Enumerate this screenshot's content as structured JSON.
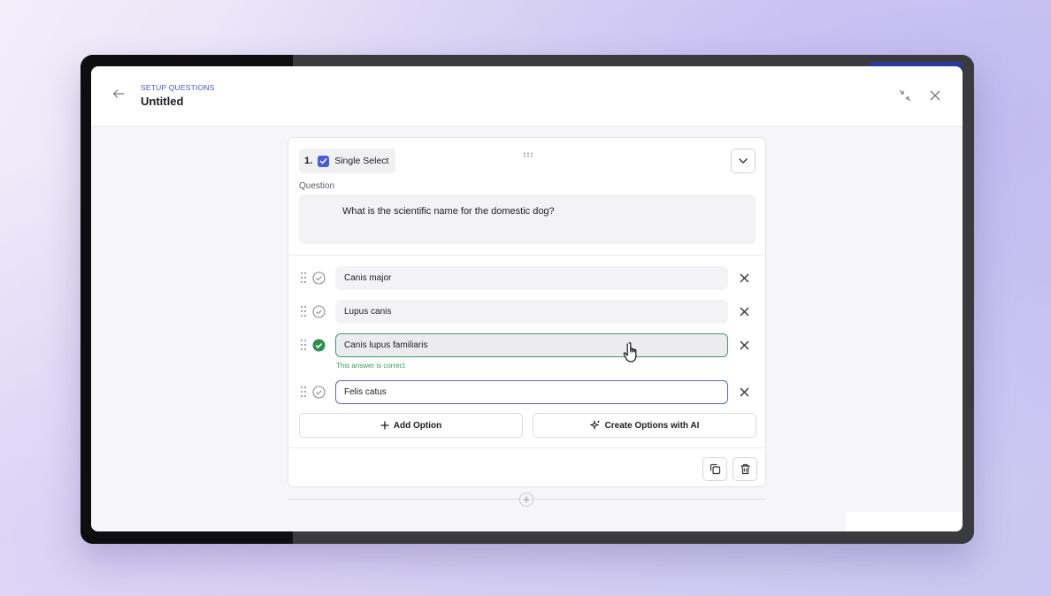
{
  "header": {
    "breadcrumb": "SETUP QUESTIONS",
    "title": "Untitled",
    "icons": {
      "back": "arrow-left-icon",
      "collapse": "collapse-icon",
      "close": "close-icon"
    }
  },
  "question": {
    "number": "1.",
    "type_label": "Single Select",
    "field_label": "Question",
    "text": "What is the scientific name for the domestic dog?"
  },
  "options": [
    {
      "label": "Canis major",
      "state": "default"
    },
    {
      "label": "Lupus canis",
      "state": "default"
    },
    {
      "label": "Canis lupus familiaris",
      "state": "correct"
    },
    {
      "label": "Felis catus",
      "state": "focused"
    }
  ],
  "correct_note": "This answer is correct",
  "actions": {
    "add_option": "Add Option",
    "create_ai": "Create Options with AI"
  },
  "colors": {
    "accent": "#4a5bdc",
    "correct": "#3e9a62",
    "link": "#4453c9"
  }
}
